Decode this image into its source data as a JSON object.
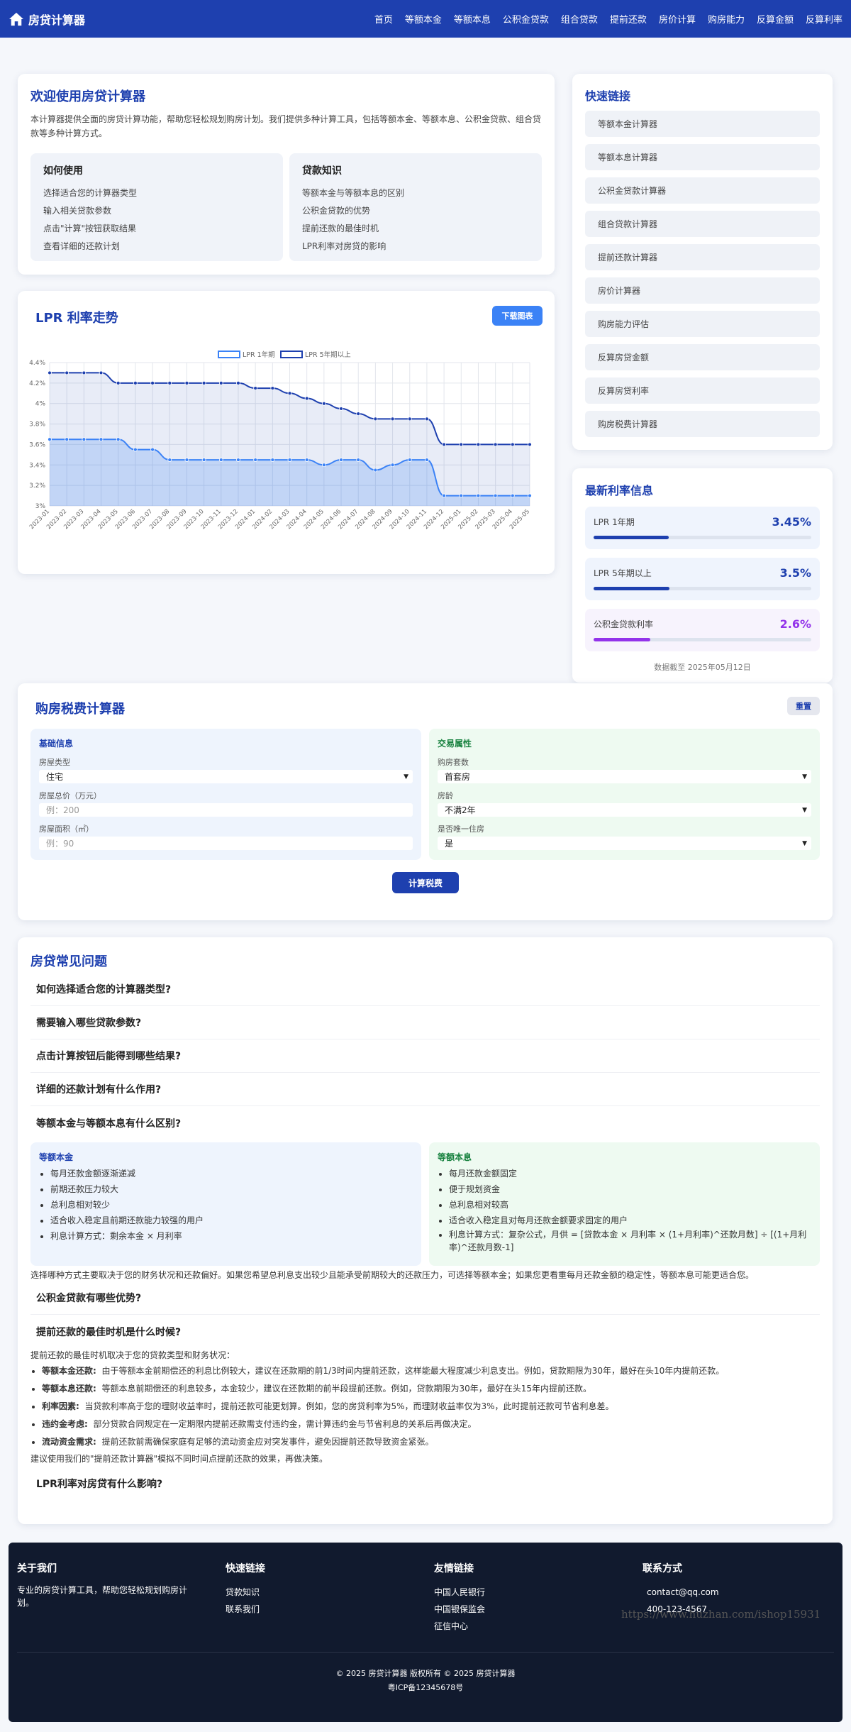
{
  "nav": {
    "brand": "房贷计算器",
    "links": [
      "首页",
      "等额本金",
      "等额本息",
      "公积金贷款",
      "组合贷款",
      "提前还款",
      "房价计算",
      "购房能力",
      "反算金额",
      "反算利率"
    ]
  },
  "welcome": {
    "title": "欢迎使用房贷计算器",
    "desc": "本计算器提供全面的房贷计算功能，帮助您轻松规划购房计划。我们提供多种计算工具，包括等额本金、等额本息、公积金贷款、组合贷款等多种计算方式。",
    "howto": {
      "title": "如何使用",
      "items": [
        "选择适合您的计算器类型",
        "输入相关贷款参数",
        "点击\"计算\"按钮获取结果",
        "查看详细的还款计划"
      ]
    },
    "knowledge": {
      "title": "贷款知识",
      "items": [
        "等额本金与等额本息的区别",
        "公积金贷款的优势",
        "提前还款的最佳时机",
        "LPR利率对房贷的影响"
      ]
    }
  },
  "chart": {
    "title": "LPR 利率走势",
    "download_label": "下载图表"
  },
  "chart_data": {
    "type": "line",
    "title": "",
    "xlabel": "",
    "ylabel": "",
    "ylim": [
      3.0,
      4.4
    ],
    "grid": true,
    "legend_position": "top",
    "yticks": [
      "3%",
      "3.2%",
      "3.4%",
      "3.6%",
      "3.8%",
      "4%",
      "4.2%",
      "4.4%"
    ],
    "categories": [
      "2023-01",
      "2023-02",
      "2023-03",
      "2023-04",
      "2023-05",
      "2023-06",
      "2023-07",
      "2023-08",
      "2023-09",
      "2023-10",
      "2023-11",
      "2023-12",
      "2024-01",
      "2024-02",
      "2024-03",
      "2024-04",
      "2024-05",
      "2024-06",
      "2024-07",
      "2024-08",
      "2024-09",
      "2024-10",
      "2024-11",
      "2024-12",
      "2025-01",
      "2025-02",
      "2025-03",
      "2025-04",
      "2025-05"
    ],
    "series": [
      {
        "name": "LPR 1年期",
        "color": "#3b82f6",
        "values": [
          3.65,
          3.65,
          3.65,
          3.65,
          3.65,
          3.55,
          3.55,
          3.45,
          3.45,
          3.45,
          3.45,
          3.45,
          3.45,
          3.45,
          3.45,
          3.45,
          3.4,
          3.45,
          3.45,
          3.35,
          3.4,
          3.45,
          3.45,
          3.1,
          3.1,
          3.1,
          3.1,
          3.1,
          3.1
        ]
      },
      {
        "name": "LPR 5年期以上",
        "color": "#1e40af",
        "values": [
          4.3,
          4.3,
          4.3,
          4.3,
          4.2,
          4.2,
          4.2,
          4.2,
          4.2,
          4.2,
          4.2,
          4.2,
          4.15,
          4.15,
          4.1,
          4.05,
          4.0,
          3.95,
          3.9,
          3.85,
          3.85,
          3.85,
          3.85,
          3.6,
          3.6,
          3.6,
          3.6,
          3.6,
          3.6
        ]
      }
    ]
  },
  "quick_links": {
    "title": "快速链接",
    "items": [
      "等额本金计算器",
      "等额本息计算器",
      "公积金贷款计算器",
      "组合贷款计算器",
      "提前还款计算器",
      "房价计算器",
      "购房能力评估",
      "反算房贷金额",
      "反算房贷利率",
      "购房税费计算器"
    ]
  },
  "rates": {
    "title": "最新利率信息",
    "items": [
      {
        "label": "LPR 1年期",
        "value": "3.45%",
        "fill": 0.345,
        "color": "#1e40af",
        "bg": "#eff4fd"
      },
      {
        "label": "LPR 5年期以上",
        "value": "3.5%",
        "fill": 0.35,
        "color": "#1e40af",
        "bg": "#eff4fd"
      },
      {
        "label": "公积金贷款利率",
        "value": "2.6%",
        "fill": 0.26,
        "color": "#9333ea",
        "bg": "#f7f3fd"
      }
    ],
    "updated": "数据截至 2025年05月12日"
  },
  "tax": {
    "title": "购房税费计算器",
    "reset_label": "重置",
    "basic": {
      "title": "基础信息",
      "type_label": "房屋类型",
      "type_value": "住宅",
      "price_label": "房屋总价（万元）",
      "price_placeholder": "例：200",
      "area_label": "房屋面积（㎡）",
      "area_placeholder": "例：90"
    },
    "trade": {
      "title": "交易属性",
      "count_label": "购房套数",
      "count_value": "首套房",
      "age_label": "房龄",
      "age_value": "不满2年",
      "only_label": "是否唯一住房",
      "only_value": "是"
    },
    "submit_label": "计算税费"
  },
  "faq": {
    "title": "房贷常见问题",
    "q1": "如何选择适合您的计算器类型?",
    "q2": "需要输入哪些贷款参数?",
    "q3": "点击计算按钮后能得到哪些结果?",
    "q4": "详细的还款计划有什么作用?",
    "q5": "等额本金与等额本息有什么区别?",
    "principal": {
      "title": "等额本金",
      "items": [
        "每月还款金额逐渐递减",
        "前期还款压力较大",
        "总利息相对较少",
        "适合收入稳定且前期还款能力较强的用户",
        "利息计算方式：剩余本金 × 月利率"
      ]
    },
    "annuity": {
      "title": "等额本息",
      "items": [
        "每月还款金额固定",
        "便于规划资金",
        "总利息相对较高",
        "适合收入稳定且对每月还款金额要求固定的用户",
        "利息计算方式：复杂公式，月供 = [贷款本金 × 月利率 × (1+月利率)^还款月数] ÷ [(1+月利率)^还款月数-1]"
      ]
    },
    "choice_note": "选择哪种方式主要取决于您的财务状况和还款偏好。如果您希望总利息支出较少且能承受前期较大的还款压力，可选择等额本金；如果您更看重每月还款金额的稳定性，等额本息可能更适合您。",
    "q6": "公积金贷款有哪些优势?",
    "q7": "提前还款的最佳时机是什么时候?",
    "prepay_intro": "提前还款的最佳时机取决于您的贷款类型和财务状况：",
    "prepay_items": [
      {
        "k": "等额本金还款:",
        "v": "由于等额本金前期偿还的利息比例较大，建议在还款期的前1/3时间内提前还款，这样能最大程度减少利息支出。例如，贷款期限为30年，最好在头10年内提前还款。"
      },
      {
        "k": "等额本息还款:",
        "v": "等额本息前期偿还的利息较多，本金较少，建议在还款期的前半段提前还款。例如，贷款期限为30年，最好在头15年内提前还款。"
      },
      {
        "k": "利率因素:",
        "v": "当贷款利率高于您的理财收益率时，提前还款可能更划算。例如，您的房贷利率为5%，而理财收益率仅为3%，此时提前还款可节省利息差。"
      },
      {
        "k": "违约金考虑:",
        "v": "部分贷款合同规定在一定期限内提前还款需支付违约金，需计算违约金与节省利息的关系后再做决定。"
      },
      {
        "k": "流动资金需求:",
        "v": "提前还款前需确保家庭有足够的流动资金应对突发事件，避免因提前还款导致资金紧张。"
      }
    ],
    "prepay_note": "建议使用我们的\"提前还款计算器\"模拟不同时间点提前还款的效果，再做决策。",
    "q8": "LPR利率对房贷有什么影响?"
  },
  "footer": {
    "about_title": "关于我们",
    "about_text": "专业的房贷计算工具，帮助您轻松规划购房计划。",
    "links_title": "快速链接",
    "links": [
      "贷款知识",
      "联系我们"
    ],
    "friends_title": "友情链接",
    "friends": [
      "中国人民银行",
      "中国银保监会",
      "征信中心"
    ],
    "contact_title": "联系方式",
    "email": "contact@qq.com",
    "phone": "400-123-4567",
    "copyright": "© 2025 房贷计算器 版权所有 © 2025 房贷计算器",
    "icp": "粤ICP备12345678号"
  },
  "watermark": "https://www.huzhan.com/ishop15931"
}
